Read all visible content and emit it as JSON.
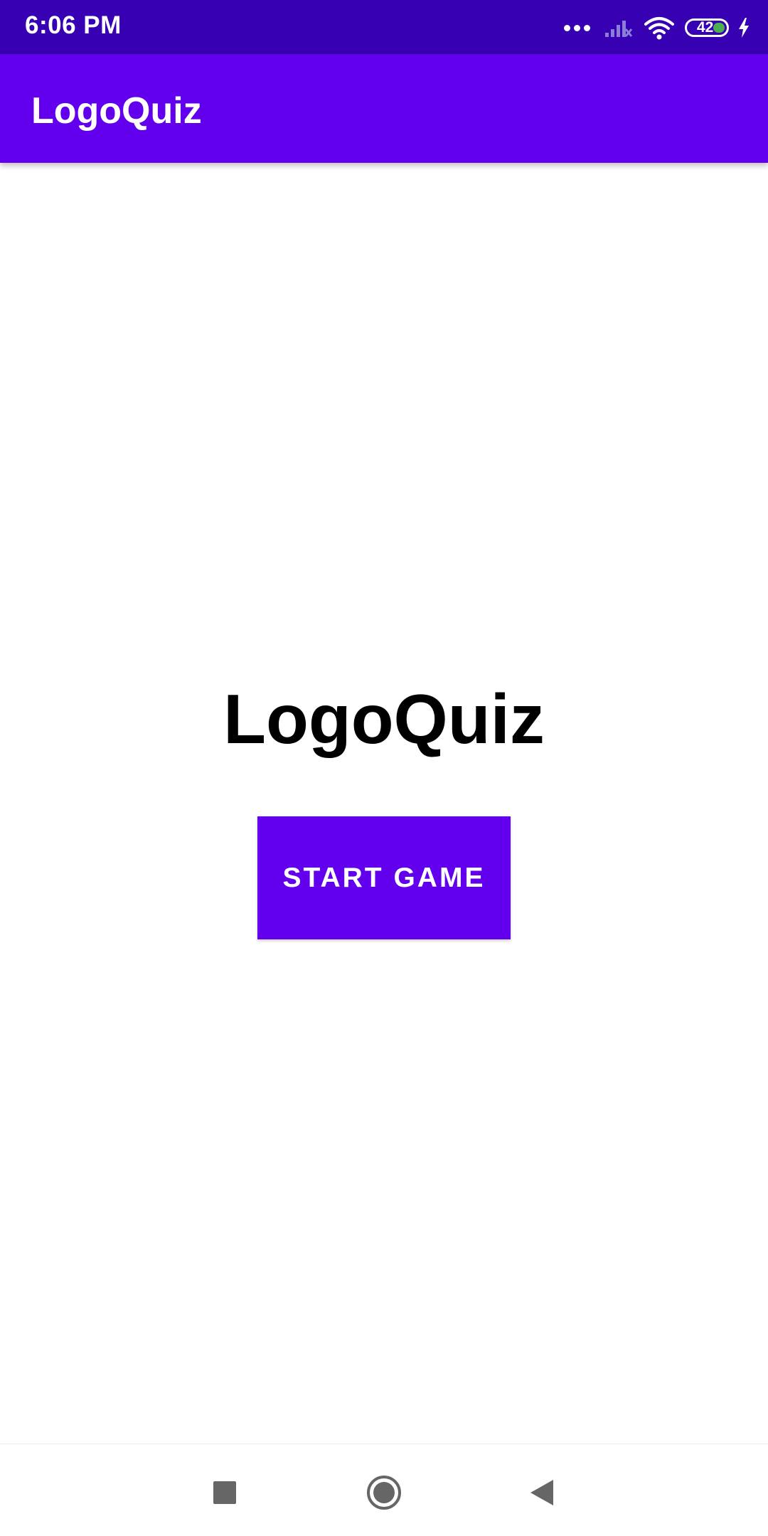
{
  "status_bar": {
    "time": "6:06 PM",
    "battery_level": "42",
    "background": "#3700b3"
  },
  "app_bar": {
    "title": "LogoQuiz",
    "background": "#6200ee"
  },
  "main": {
    "title": "LogoQuiz",
    "start_button_label": "START GAME",
    "button_color": "#6200ee"
  },
  "nav_bar": {
    "icons": [
      "recent-apps-icon",
      "home-icon",
      "back-icon"
    ]
  }
}
